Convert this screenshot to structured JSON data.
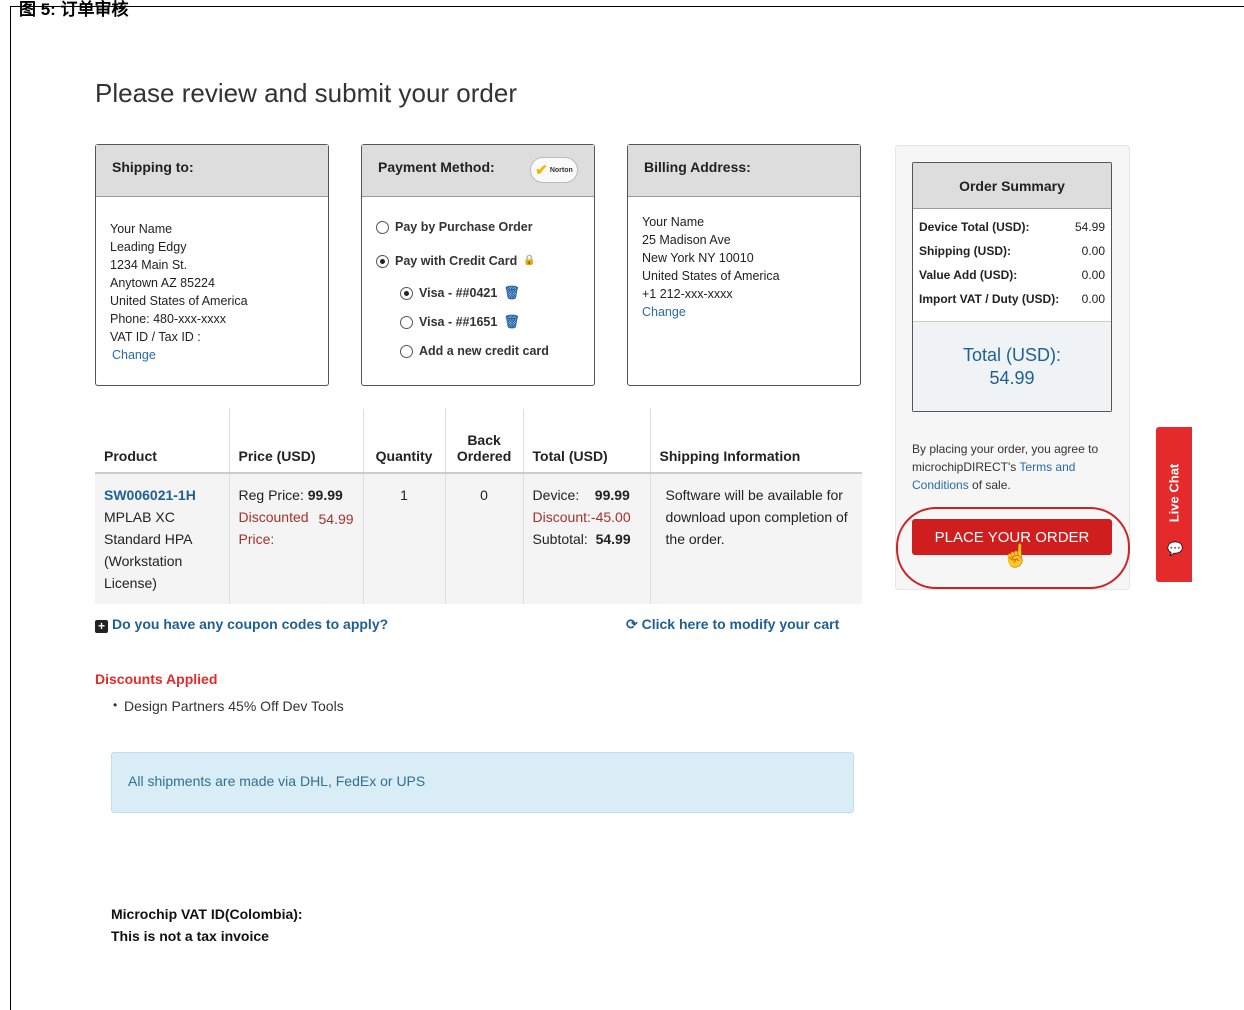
{
  "caption": "图 5:    订单审核",
  "page_title": "Please review and submit your order",
  "shipping": {
    "title": "Shipping to:",
    "lines": [
      "Your Name",
      "Leading Edgy",
      "1234 Main St.",
      "Anytown AZ  85224",
      "United States of America",
      "Phone: 480-xxx-xxxx",
      "VAT ID / Tax ID :"
    ],
    "change": "Change"
  },
  "payment": {
    "title": "Payment Method:",
    "badge": "Norton",
    "options": [
      "Pay by Purchase Order",
      "Pay with Credit Card"
    ],
    "cards": [
      "Visa - ##0421",
      "Visa - ##1651"
    ],
    "add_card": "Add a new credit card"
  },
  "billing": {
    "title": "Billing Address:",
    "lines": [
      "Your Name",
      "25 Madison Ave",
      "New York NY 10010",
      "United States of America",
      "+1 212-xxx-xxxx"
    ],
    "change": "Change"
  },
  "table": {
    "headers": [
      "Product",
      "Price (USD)",
      "Quantity",
      "Back Ordered",
      "Total (USD)",
      "Shipping Information"
    ],
    "sku": "SW006021-1H",
    "product_desc": "MPLAB XC Standard HPA (Workstation License)",
    "reg_price_label": "Reg Price:",
    "reg_price": "99.99",
    "disc_price_label": "Discounted Price:",
    "disc_price": "54.99",
    "quantity": "1",
    "back_ordered": "0",
    "device_label": "Device:",
    "device": "99.99",
    "discount_label": "Discount:",
    "discount": "-45.00",
    "subtotal_label": "Subtotal:",
    "subtotal": "54.99",
    "shipping_info": "Software will be available for download upon completion of the order."
  },
  "coupon": "Do you have any coupon codes to apply?",
  "modify": "Click here to modify your cart",
  "discounts": {
    "title": "Discounts Applied",
    "items": [
      "Design Partners 45% Off Dev Tools"
    ]
  },
  "ship_note": "All shipments are made via DHL, FedEx or UPS",
  "vat": {
    "line1": "Microchip VAT ID(Colombia):",
    "line2": "This is not a tax invoice"
  },
  "summary": {
    "title": "Order Summary",
    "rows": [
      {
        "label": "Device Total (USD):",
        "value": "54.99"
      },
      {
        "label": "Shipping (USD):",
        "value": "0.00"
      },
      {
        "label": "Value Add (USD):",
        "value": "0.00"
      },
      {
        "label": "Import VAT / Duty (USD):",
        "value": "0.00"
      }
    ],
    "total_label": "Total (USD):",
    "total_value": "54.99",
    "agree_pre": "By placing your order, you agree to microchipDIRECT's ",
    "agree_link": "Terms and Conditions",
    "agree_post": " of sale.",
    "button": "PLACE YOUR ORDER"
  },
  "live_chat": "Live Chat"
}
